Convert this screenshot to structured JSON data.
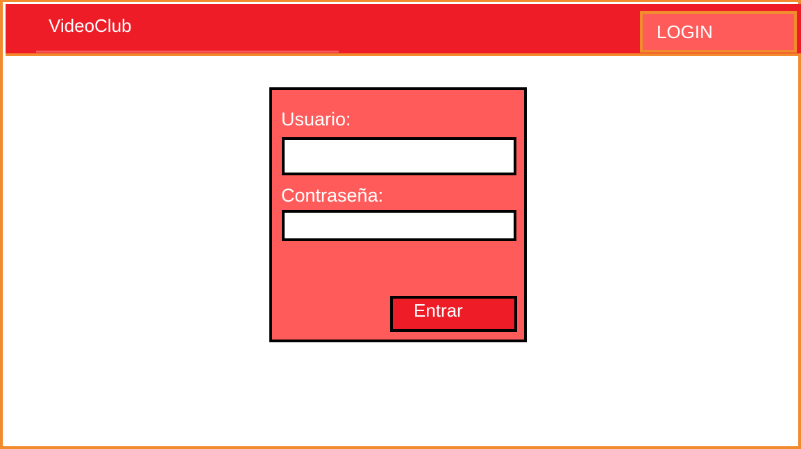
{
  "header": {
    "brand": "VideoClub",
    "login_label": "LOGIN"
  },
  "login_form": {
    "username_label": "Usuario:",
    "username_value": "",
    "password_label": "Contraseña:",
    "password_value": "",
    "submit_label": "Entrar"
  },
  "colors": {
    "header_red": "#ee1c27",
    "panel_red": "#ff5b5b",
    "border_orange": "#f28a2e",
    "text_white": "#ffffff"
  }
}
